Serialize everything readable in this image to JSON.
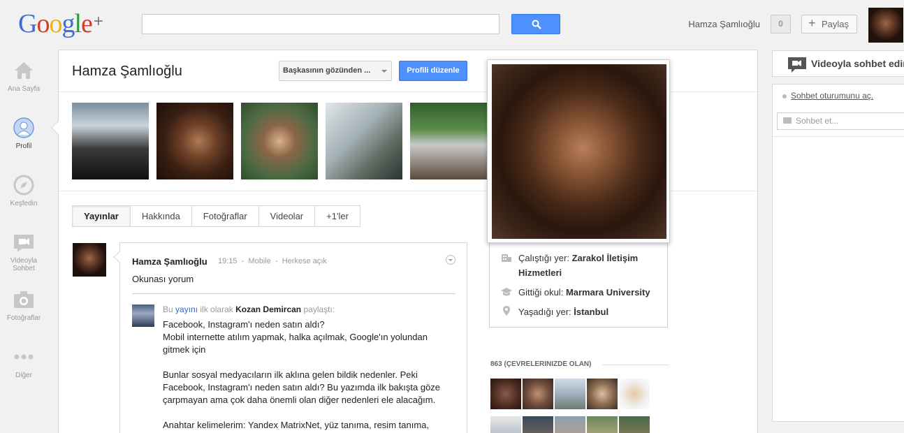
{
  "app": {
    "logo_text": "Google",
    "logo_plus": "+"
  },
  "topbar": {
    "search_placeholder": "",
    "user_name": "Hamza Şamlıoğlu",
    "notification_count": "0",
    "share_label": "Paylaş"
  },
  "nav": {
    "items": [
      {
        "label": "Ana Sayfa",
        "icon": "home-icon"
      },
      {
        "label": "Profil",
        "icon": "profile-icon"
      },
      {
        "label": "Keşfedin",
        "icon": "compass-icon"
      },
      {
        "label": "Videoyla Sohbet",
        "icon": "video-chat-icon"
      },
      {
        "label": "Fotoğraflar",
        "icon": "camera-icon"
      },
      {
        "label": "Diğer",
        "icon": "more-icon"
      }
    ],
    "active": "Profil"
  },
  "profile": {
    "name": "Hamza Şamlıoğlu",
    "view_as_label": "Başkasının gözünden ...",
    "edit_label": "Profili düzenle"
  },
  "tabs": [
    "Yayınlar",
    "Hakkında",
    "Fotoğraflar",
    "Videolar",
    "+1'ler"
  ],
  "post": {
    "author": "Hamza Şamlıoğlu",
    "time": "19:15",
    "source": "Mobile",
    "visibility": "Herkese açık",
    "text": "Okunası yorum",
    "reshare": {
      "prefix": "Bu",
      "link": "yayını",
      "middle": "ilk olarak",
      "original_author": "Kozan Demircan",
      "suffix": "paylaştı:",
      "paragraphs": [
        "Facebook, Instagram'ı neden satın aldı?\nMobil internette atılım yapmak, halka açılmak, Google'ın yolundan gitmek için",
        "Bunlar sosyal medyacıların ilk aklına gelen bildik nedenler. Peki Facebook, Instagram'ı neden satın aldı? Bu yazımda ilk bakışta göze çarpmayan ama çok daha önemli olan diğer nedenleri ele alacağım.",
        "Anahtar kelimelerim: Yandex MatrixNet, yüz tanıma, resim tanıma,"
      ]
    }
  },
  "hovercard": {
    "work_label": "Çalıştığı yer:",
    "work_value": "Zarakol İletişim Hizmetleri",
    "school_label": "Gittiği okul:",
    "school_value": "Marmara University",
    "lives_label": "Yaşadığı yer:",
    "lives_value": "İstanbul"
  },
  "circles": {
    "heading": "863 (ÇEVRELERINIZDE OLAN)"
  },
  "chat": {
    "video_label": "Videoyla sohbet edin",
    "login_label": "Sohbet oturumunu aç.",
    "input_placeholder": "Sohbet et..."
  },
  "colors": {
    "accent": "#4d90fe",
    "link": "#3366cc"
  }
}
